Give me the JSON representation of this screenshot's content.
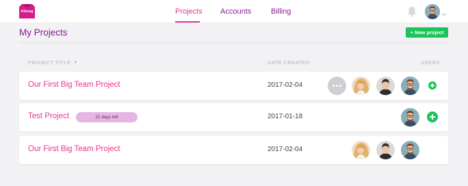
{
  "app": {
    "logo_text": "HSmag"
  },
  "nav": {
    "items": [
      {
        "label": "Projects",
        "active": true
      },
      {
        "label": "Accounts",
        "active": false
      },
      {
        "label": "Billing",
        "active": false
      }
    ]
  },
  "header_icons": {
    "notifications": "bell-icon",
    "user_menu": "chevron-down-icon"
  },
  "page": {
    "title": "My Projects",
    "new_project_label": "+ New project"
  },
  "table": {
    "columns": {
      "title": "PROJECT TITLE",
      "date": "DATE CREATED",
      "users": "USERS"
    },
    "rows": [
      {
        "title": "Our First Big Team Project",
        "badge": "",
        "date": "2017-02-04",
        "has_more_users": true,
        "users": [
          "blonde-woman",
          "dark-hair-man",
          "bearded-man-glasses"
        ]
      },
      {
        "title": "Test Project",
        "badge": "21 days left",
        "date": "2017-01-18",
        "has_more_users": false,
        "users": [
          "bearded-man-glasses"
        ]
      },
      {
        "title": "Our First Big Team Project",
        "badge": "",
        "date": "2017-02-04",
        "has_more_users": false,
        "users": [
          "blonde-woman",
          "dark-hair-man",
          "bearded-man-glasses"
        ]
      }
    ]
  },
  "colors": {
    "accent_pink": "#e8348d",
    "brand_purple": "#8a1b8f",
    "action_green": "#1bc45a",
    "badge_bg": "#e5b6e3"
  }
}
